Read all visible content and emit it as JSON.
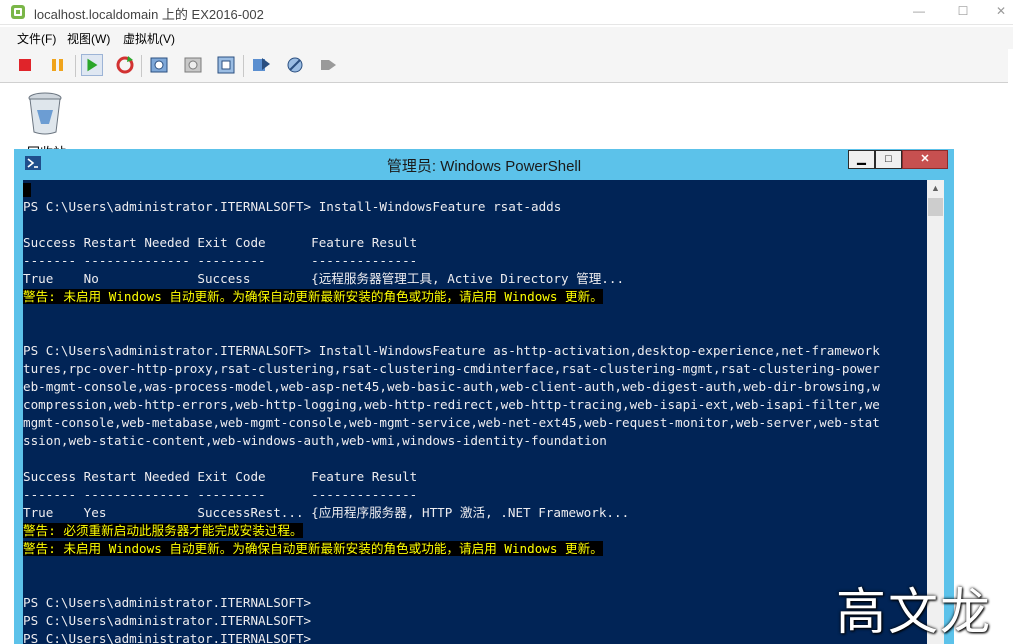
{
  "vm_window": {
    "title": "localhost.localdomain 上的 EX2016-002",
    "menu": [
      "文件(F)",
      "视图(W)",
      "虚拟机(V)"
    ]
  },
  "desktop": {
    "recycle_bin_label": "回收站"
  },
  "powershell": {
    "title": "管理员: Windows PowerShell",
    "lines": [
      {
        "text": "",
        "type": "cursor"
      },
      {
        "text": "PS C:\\Users\\administrator.ITERNALSOFT> Install-WindowsFeature rsat-adds",
        "type": "normal"
      },
      {
        "text": "",
        "type": "normal"
      },
      {
        "text": "Success Restart Needed Exit Code      Feature Result",
        "type": "normal"
      },
      {
        "text": "------- -------------- ---------      --------------",
        "type": "normal"
      },
      {
        "text": "True    No             Success        {远程服务器管理工具, Active Directory 管理...",
        "type": "normal"
      },
      {
        "text": "警告: 未启用 Windows 自动更新。为确保自动更新最新安装的角色或功能，请启用 Windows 更新。",
        "type": "warn"
      },
      {
        "text": "",
        "type": "normal"
      },
      {
        "text": "",
        "type": "normal"
      },
      {
        "text": "PS C:\\Users\\administrator.ITERNALSOFT> Install-WindowsFeature as-http-activation,desktop-experience,net-framework",
        "type": "normal"
      },
      {
        "text": "tures,rpc-over-http-proxy,rsat-clustering,rsat-clustering-cmdinterface,rsat-clustering-mgmt,rsat-clustering-power",
        "type": "normal"
      },
      {
        "text": "eb-mgmt-console,was-process-model,web-asp-net45,web-basic-auth,web-client-auth,web-digest-auth,web-dir-browsing,w",
        "type": "normal"
      },
      {
        "text": "compression,web-http-errors,web-http-logging,web-http-redirect,web-http-tracing,web-isapi-ext,web-isapi-filter,we",
        "type": "normal"
      },
      {
        "text": "mgmt-console,web-metabase,web-mgmt-console,web-mgmt-service,web-net-ext45,web-request-monitor,web-server,web-stat",
        "type": "normal"
      },
      {
        "text": "ssion,web-static-content,web-windows-auth,web-wmi,windows-identity-foundation",
        "type": "normal"
      },
      {
        "text": "",
        "type": "normal"
      },
      {
        "text": "Success Restart Needed Exit Code      Feature Result",
        "type": "normal"
      },
      {
        "text": "------- -------------- ---------      --------------",
        "type": "normal"
      },
      {
        "text": "True    Yes            SuccessRest... {应用程序服务器, HTTP 激活, .NET Framework...",
        "type": "normal"
      },
      {
        "text": "警告: 必须重新启动此服务器才能完成安装过程。",
        "type": "warn"
      },
      {
        "text": "警告: 未启用 Windows 自动更新。为确保自动更新最新安装的角色或功能，请启用 Windows 更新。",
        "type": "warn"
      },
      {
        "text": "",
        "type": "normal"
      },
      {
        "text": "",
        "type": "normal"
      },
      {
        "text": "PS C:\\Users\\administrator.ITERNALSOFT>",
        "type": "normal"
      },
      {
        "text": "PS C:\\Users\\administrator.ITERNALSOFT>",
        "type": "normal"
      },
      {
        "text": "PS C:\\Users\\administrator.ITERNALSOFT>",
        "type": "normal"
      }
    ]
  },
  "watermark": "高文龙",
  "colors": {
    "console_bg": "#012456",
    "console_fg": "#eeedf0",
    "warning_fg": "#ffff00",
    "titlebar_bg": "#5cc2ea"
  }
}
